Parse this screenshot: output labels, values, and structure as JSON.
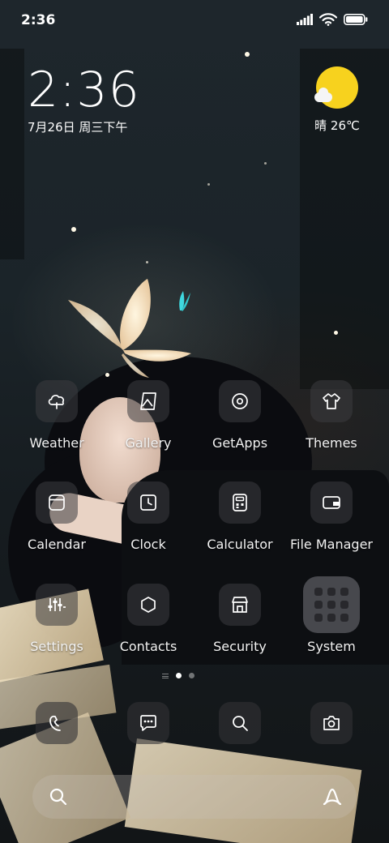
{
  "status_bar": {
    "time": "2:36",
    "icons": [
      "signal-icon",
      "wifi-icon",
      "battery-icon"
    ]
  },
  "clock_widget": {
    "time": "2:36",
    "date": "7月26日 周三下午"
  },
  "weather_widget": {
    "condition_temp": "晴 26℃",
    "icon": "sunny-icon",
    "sun_color": "#f7d21e"
  },
  "apps": [
    {
      "label": "Weather",
      "icon": "cloud-icon"
    },
    {
      "label": "Gallery",
      "icon": "image-icon"
    },
    {
      "label": "GetApps",
      "icon": "location-pin-icon"
    },
    {
      "label": "Themes",
      "icon": "tshirt-icon"
    },
    {
      "label": "Calendar",
      "icon": "calendar-icon"
    },
    {
      "label": "Clock",
      "icon": "clock-icon"
    },
    {
      "label": "Calculator",
      "icon": "calculator-icon"
    },
    {
      "label": "File Manager",
      "icon": "folder-icon"
    },
    {
      "label": "Settings",
      "icon": "sliders-icon"
    },
    {
      "label": "Contacts",
      "icon": "contacts-icon"
    },
    {
      "label": "Security",
      "icon": "shield-shop-icon"
    },
    {
      "label": "System",
      "icon": "folder-grid-icon"
    }
  ],
  "page_indicator": {
    "pages": 2,
    "active_page": 1
  },
  "dock": [
    "phone-icon",
    "messages-icon",
    "browser-search-icon",
    "camera-icon"
  ],
  "search_bar": {
    "icons": [
      "search-icon",
      "assistant-icon"
    ]
  }
}
